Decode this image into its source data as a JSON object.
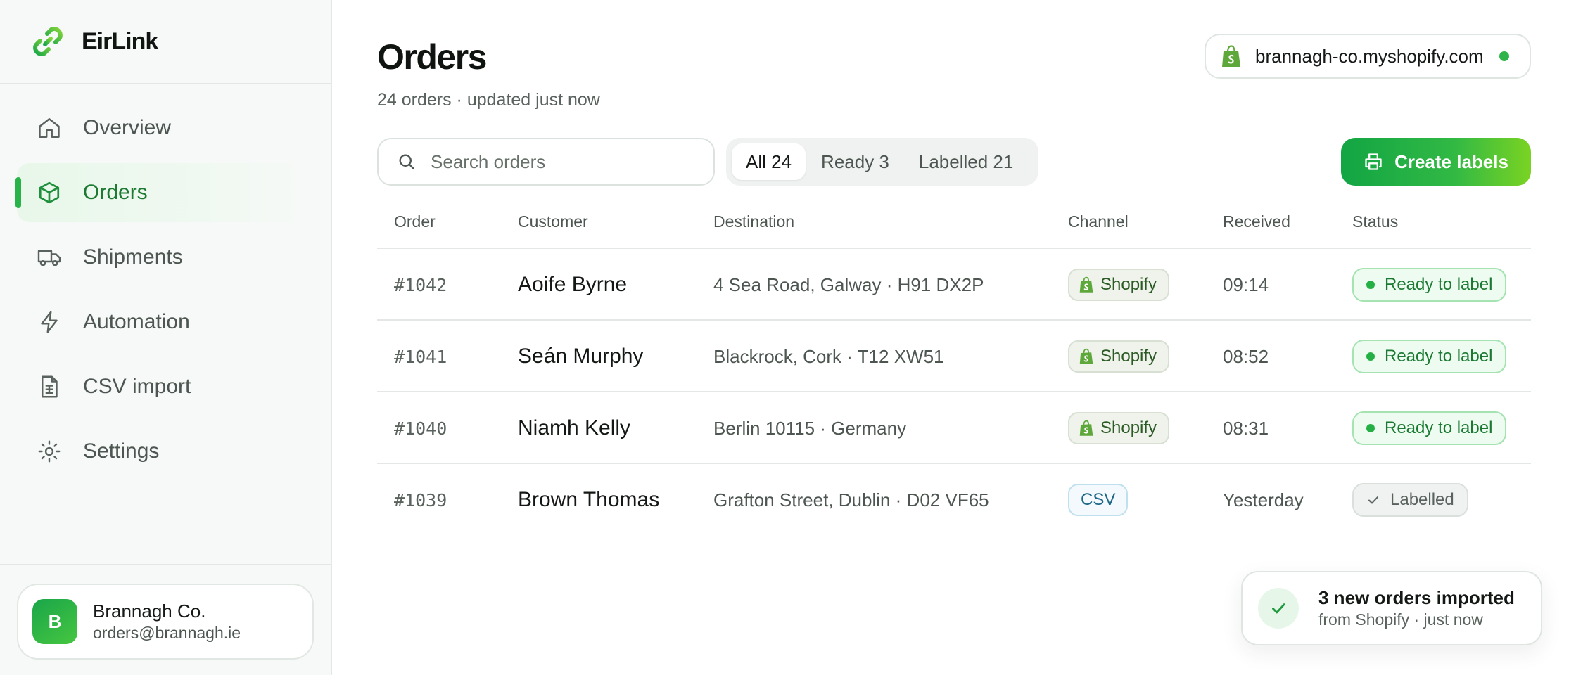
{
  "app": {
    "name": "EirLink"
  },
  "sidebar": {
    "items": [
      {
        "label": "Overview",
        "icon": "home-icon",
        "active": false
      },
      {
        "label": "Orders",
        "icon": "box-icon",
        "active": true
      },
      {
        "label": "Shipments",
        "icon": "truck-icon",
        "active": false
      },
      {
        "label": "Automation",
        "icon": "bolt-icon",
        "active": false
      },
      {
        "label": "CSV import",
        "icon": "file-spreadsheet-icon",
        "active": false
      },
      {
        "label": "Settings",
        "icon": "gear-icon",
        "active": false
      }
    ],
    "account": {
      "initial": "B",
      "name": "Brannagh Co.",
      "email": "orders@brannagh.ie"
    }
  },
  "header": {
    "title": "Orders",
    "subtitle": "24 orders · updated just now",
    "store": {
      "domain": "brannagh-co.myshopify.com",
      "status": "connected",
      "status_color": "#2fb44c"
    }
  },
  "toolbar": {
    "search_placeholder": "Search orders",
    "search_value": "",
    "filters": [
      {
        "label": "All 24",
        "active": true
      },
      {
        "label": "Ready 3",
        "active": false
      },
      {
        "label": "Labelled 21",
        "active": false
      }
    ],
    "create_label": "Create labels"
  },
  "table": {
    "columns": [
      "Order",
      "Customer",
      "Destination",
      "Channel",
      "Received",
      "Status"
    ],
    "rows": [
      {
        "order": "#1042",
        "customer": "Aoife Byrne",
        "destination": "4 Sea Road, Galway · H91 DX2P",
        "channel": "Shopify",
        "received": "09:14",
        "status": "Ready to label"
      },
      {
        "order": "#1041",
        "customer": "Seán Murphy",
        "destination": "Blackrock, Cork · T12 XW51",
        "channel": "Shopify",
        "received": "08:52",
        "status": "Ready to label"
      },
      {
        "order": "#1040",
        "customer": "Niamh Kelly",
        "destination": "Berlin 10115 · Germany",
        "channel": "Shopify",
        "received": "08:31",
        "status": "Ready to label"
      },
      {
        "order": "#1039",
        "customer": "Brown Thomas",
        "destination": "Grafton Street, Dublin · D02 VF65",
        "channel": "CSV",
        "received": "Yesterday",
        "status": "Labelled"
      }
    ]
  },
  "toast": {
    "title": "3 new orders imported",
    "subtitle": "from Shopify · just now"
  },
  "colors": {
    "accent": "#28b24a",
    "accent_dark": "#1d7a32",
    "ready_badge": "#eefbf0",
    "labelled_badge": "#f0f2f1"
  }
}
